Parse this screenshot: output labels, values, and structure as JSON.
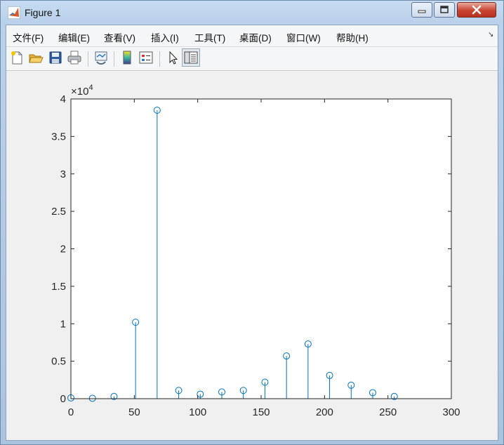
{
  "window": {
    "title": "Figure 1",
    "accent": "#0072bd"
  },
  "menubar": {
    "items": [
      {
        "label": "文件(F)"
      },
      {
        "label": "编辑(E)"
      },
      {
        "label": "查看(V)"
      },
      {
        "label": "插入(I)"
      },
      {
        "label": "工具(T)"
      },
      {
        "label": "桌面(D)"
      },
      {
        "label": "窗口(W)"
      },
      {
        "label": "帮助(H)"
      }
    ]
  },
  "toolbar": {
    "buttons": [
      {
        "icon": "new-figure-icon"
      },
      {
        "icon": "open-file-icon"
      },
      {
        "icon": "save-icon"
      },
      {
        "icon": "print-icon"
      },
      {
        "icon": "link-plot-icon"
      },
      {
        "icon": "colorbar-icon"
      },
      {
        "icon": "legend-icon"
      },
      {
        "icon": "pointer-icon"
      },
      {
        "icon": "property-inspector-icon"
      }
    ]
  },
  "chart_data": {
    "type": "stem",
    "title": "",
    "xlabel": "",
    "ylabel": "",
    "exponent_label": "×10",
    "exponent_power": "4",
    "xlim": [
      0,
      300
    ],
    "ylim": [
      0,
      40000
    ],
    "xticks": [
      0,
      50,
      100,
      150,
      200,
      250,
      300
    ],
    "yticks": [
      0,
      5000,
      10000,
      15000,
      20000,
      25000,
      30000,
      35000,
      40000
    ],
    "ytick_labels": [
      "0",
      "0.5",
      "1",
      "1.5",
      "2",
      "2.5",
      "3",
      "3.5",
      "4"
    ],
    "grid": false,
    "color": "#0072bd",
    "x": [
      0,
      17,
      34,
      51,
      68,
      85,
      102,
      119,
      136,
      153,
      170,
      187,
      204,
      221,
      238,
      255
    ],
    "values": [
      100,
      50,
      300,
      10200,
      38500,
      1100,
      600,
      900,
      1100,
      2200,
      5700,
      7300,
      3100,
      1800,
      800,
      300
    ]
  }
}
